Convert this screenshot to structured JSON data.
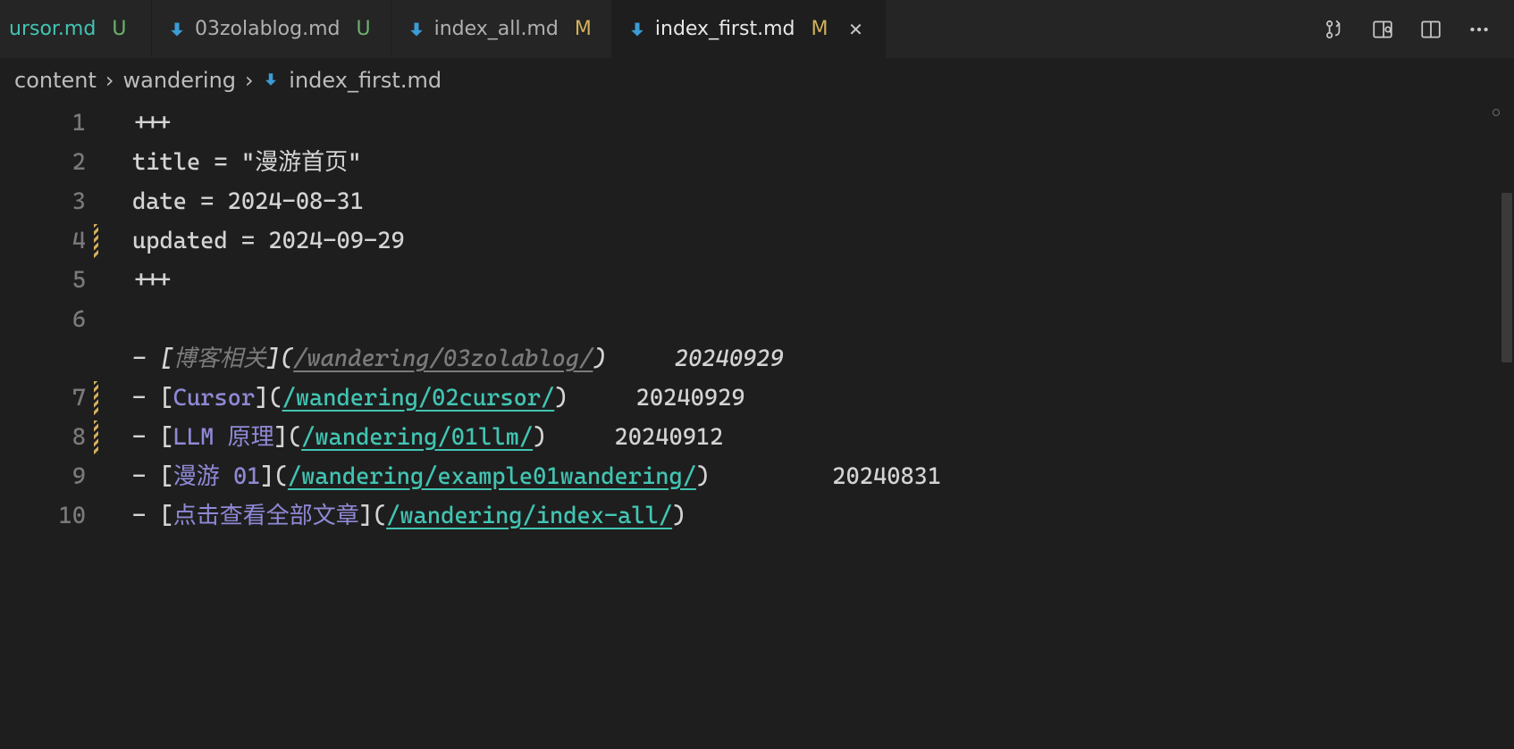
{
  "tabs": [
    {
      "label": "ursor.md",
      "status": "U",
      "icon": "down-arrow",
      "active": false
    },
    {
      "label": "03zolablog.md",
      "status": "U",
      "icon": "down-arrow",
      "active": false
    },
    {
      "label": "index_all.md",
      "status": "M",
      "icon": "down-arrow",
      "active": false
    },
    {
      "label": "index_first.md",
      "status": "M",
      "icon": "down-arrow",
      "active": true,
      "closeable": true
    }
  ],
  "actions": {
    "compare_tip": "Open Changes",
    "preview_tip": "Open Preview",
    "split_tip": "Split Editor",
    "more_tip": "More Actions"
  },
  "breadcrumb": {
    "segments": [
      "content",
      "wandering",
      "index_first.md"
    ],
    "sep": "›"
  },
  "editor": {
    "lines": [
      {
        "num": "1",
        "kind": "plain",
        "text": "+++"
      },
      {
        "num": "2",
        "kind": "plain",
        "text": "title = \"漫游首页\""
      },
      {
        "num": "3",
        "kind": "plain",
        "text": "date = 2024-08-31"
      },
      {
        "num": "4",
        "kind": "plain",
        "text": "updated = 2024-09-29",
        "modified": true
      },
      {
        "num": "5",
        "kind": "plain",
        "text": "+++"
      },
      {
        "num": "6",
        "kind": "plain",
        "text": ""
      },
      {
        "num": "",
        "kind": "deleted",
        "prefix": "- [",
        "linkText": "博客相关",
        "mid": "](",
        "url": "/wandering/03zolablog/",
        "suffix": ")",
        "trail": "     20240929"
      },
      {
        "num": "7",
        "kind": "link",
        "modified": true,
        "prefix": "- [",
        "linkText": "Cursor",
        "mid": "](",
        "url": "/wandering/02cursor/",
        "suffix": ")",
        "trail": "     20240929"
      },
      {
        "num": "8",
        "kind": "link",
        "modified": true,
        "prefix": "- [",
        "linkText": "LLM 原理",
        "mid": "](",
        "url": "/wandering/01llm/",
        "suffix": ")",
        "trail": "     20240912"
      },
      {
        "num": "9",
        "kind": "link",
        "prefix": "- [",
        "linkText": "漫游 01",
        "mid": "](",
        "url": "/wandering/example01wandering/",
        "suffix": ")",
        "trail": "         20240831"
      },
      {
        "num": "10",
        "kind": "link",
        "prefix": "- [",
        "linkText": "点击查看全部文章",
        "mid": "](",
        "url": "/wandering/index-all/",
        "suffix": ")",
        "trail": ""
      }
    ]
  }
}
